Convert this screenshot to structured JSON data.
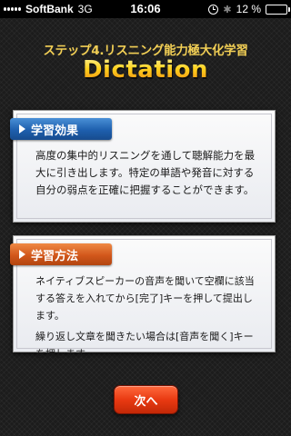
{
  "status_bar": {
    "carrier": "SoftBank",
    "network": "3G",
    "time": "16:06",
    "battery_text": "12 %",
    "battery_level": 0.12,
    "icons": [
      "signal-icon",
      "alarm-clock-icon",
      "bluetooth-icon",
      "battery-icon"
    ]
  },
  "header": {
    "subtitle": "ステップ4.リスニング能力極大化学習",
    "title": "Dictation"
  },
  "cards": [
    {
      "label": "学習効果",
      "color": "#1e5fae",
      "paragraphs": [
        "高度の集中的リスニングを通して聴解能力を最大に引き出します。特定の単語や発音に対する自分の弱点を正確に把握することができます。"
      ]
    },
    {
      "label": "学習方法",
      "color": "#d2571b",
      "paragraphs": [
        "ネイティブスピーカーの音声を聞いて空欄に該当する答えを入れてから[完了]キーを押して提出します。",
        "繰り返し文章を聞きたい場合は[音声を聞く]キーを押します。"
      ]
    }
  ],
  "next_button": {
    "label": "次へ"
  },
  "colors": {
    "title": "#ffd21e",
    "subtitle": "#f2cf55",
    "button": "#e93a12"
  }
}
